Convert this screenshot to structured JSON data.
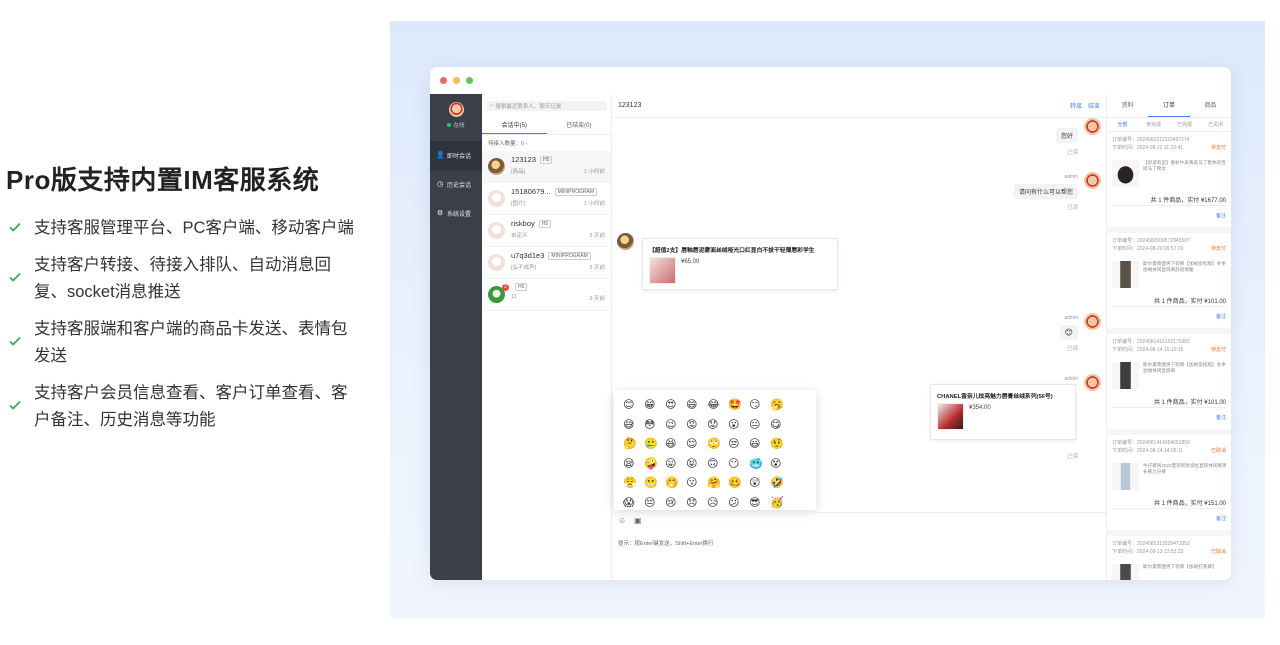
{
  "left": {
    "title": "Pro版支持内置IM客服系统",
    "features": [
      "支持客服管理平台、PC客户端、移动客户端",
      "支持客户转接、待接入排队、自动消息回复、socket消息推送",
      "支持客服端和客户端的商品卡发送、表情包发送",
      "支持客户会员信息查看、客户订单查看、客户备注、历史消息等功能"
    ]
  },
  "nav": {
    "status": "在线",
    "items": [
      {
        "label": "即时会话",
        "icon": "user-icon"
      },
      {
        "label": "历史会话",
        "icon": "clock-icon"
      },
      {
        "label": "系统设置",
        "icon": "gear-icon"
      }
    ]
  },
  "list": {
    "search_placeholder": "搜索最近联系人、聊天记录",
    "tabs": [
      "会话中(5)",
      "已结束(0)"
    ],
    "waiting_label": "待接入数量：",
    "waiting_count": "0",
    "items": [
      {
        "name": "123123",
        "tag": "H5",
        "preview": "[商品]",
        "time": "1 小时前"
      },
      {
        "name": "15180679...",
        "tag": "MINIPROGRAM",
        "preview": "[图片]",
        "time": "1 小时前"
      },
      {
        "name": "riskboy",
        "tag": "H5",
        "preview": "自定义",
        "time": "3 天前"
      },
      {
        "name": "u7q3d1e3",
        "tag": "MINIPROGRAM",
        "preview": "[弘不成声]",
        "time": "3 天前"
      },
      {
        "name": "",
        "tag": "H5",
        "preview": "11",
        "time": "3 天前",
        "badge": "2"
      }
    ]
  },
  "chat": {
    "title": "123123",
    "actions": [
      "转接",
      "结束"
    ],
    "messages": {
      "m1": {
        "text": "您好",
        "read": "已读"
      },
      "m2": {
        "sender": "admin",
        "text": "请问有什么可以帮您",
        "read": "已读"
      },
      "m3": {
        "title": "【超值2支】唇釉唇泥雾面丝绒哑光口红显白不拔干轻薄唇彩学生",
        "price": "¥65.00"
      },
      "m4": {
        "sender": "admin",
        "text": "😊",
        "read": "已读"
      },
      "m5": {
        "sender": "admin",
        "title": "CHANEL香奈儿炫亮魅力唇膏丝绒系列(56号)",
        "price": "¥354.00",
        "read": "已读"
      }
    },
    "emojis": [
      "😊",
      "😁",
      "😍",
      "😄",
      "😂",
      "🤩",
      "😏",
      "🥱",
      "😅",
      "😳",
      "😉",
      "😡",
      "😟",
      "😮",
      "😐",
      "😋",
      "🤔",
      "🥲",
      "😆",
      "😌",
      "🙄",
      "😒",
      "😃",
      "🤨",
      "😪",
      "🤪",
      "😛",
      "😝",
      "🙃",
      "😶",
      "🥶",
      "😵",
      "😤",
      "😬",
      "🤭",
      "😗",
      "🤗",
      "🥴",
      "😲",
      "🤣",
      "😱",
      "😔",
      "😢",
      "😞",
      "😥",
      "😕",
      "😎",
      "🥳"
    ],
    "hint": "提示：按Enter键发送，Shift+Enter换行"
  },
  "side": {
    "tabs": [
      "资料",
      "订单",
      "商品"
    ],
    "filters": [
      "全部",
      "未完成",
      "已完成",
      "已关闭"
    ],
    "orders": [
      {
        "no": "订单编号：2024082211322497274",
        "time": "下单时间：2024-08-22 11:32:41",
        "status": "待支付",
        "desc": "【舒适有型】春秋牛皮真皮马丁靴休闲百搭马丁靴女",
        "total": "共 1 件商品，实付 ¥1677.00",
        "note": "备注"
      },
      {
        "no": "订单编号：2024082009572945507",
        "time": "下单时间：2024-08-20 09:57:20",
        "status": "待支付",
        "desc": "斯尔曼裹面男下装裤【加绒宽松版】冬季加绒休闲直筒裤舒适保暖",
        "total": "共 1 件商品，实付 ¥101.00",
        "note": "备注"
      },
      {
        "no": "订单编号：2024081416102170383",
        "time": "下单时间：2024-08-14 16:10:15",
        "status": "待支付",
        "desc": "斯尔曼裹面男下装裤【加绒宽松版】冬季加绒休闲直筒裤",
        "total": "共 1 件商品，实付 ¥101.00",
        "note": "备注"
      },
      {
        "no": "订单编号：2024081414054652850",
        "time": "下单时间：2024-08-14 14:05:11",
        "status": "已取消",
        "desc": "牛仔裤男2023夏装新款宽松直筒休闲裤男长裤九分裤",
        "total": "共 1 件商品，实付 ¥151.00",
        "note": "备注"
      },
      {
        "no": "订单编号：2024081313535473352",
        "time": "下单时间：2024-08-13 13:53:33",
        "status": "已取消",
        "desc": "斯尔曼裹面男下装裤【加绒打底裤】",
        "total": "",
        "note": ""
      }
    ]
  },
  "colors": {
    "accent": "#4b7cf3",
    "nav_bg": "#3b3f4a",
    "check": "#2eb04f",
    "warn": "#e6722b"
  }
}
